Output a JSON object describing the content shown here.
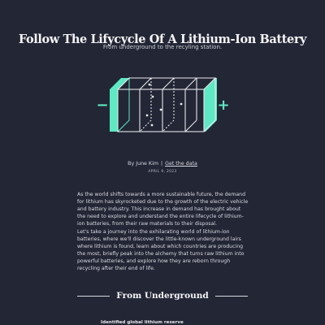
{
  "article": {
    "title": "Follow The Lifycycle Of A Lithium-Ion Battery",
    "subtitle": "From underground to the recyling station.",
    "byline": {
      "author_text": "By June Kim",
      "separator": "|",
      "data_link": "Get the data"
    },
    "date": "APRIL 9, 2023",
    "paragraphs": [
      "As the world shifts towards a more sustainable future, the demand for lithium has skyrocketed due to the growth of the electric vehicle and battery industry. This increase in demand has brought about the need to explore and understand the entire lifecycle of lithium-ion batteries, from their raw materials to their disposal.",
      "Let's take a journey into the exhilarating world of lithium-ion batteries, where we'll discover the little-known underground lairs where lithium is found, learn about which countries are producing the most, briefly peak into the alchemy that turns raw lithium into powerful batteries, and explore how they are reborn through recycling after their end of life."
    ],
    "section_heading": "From Underground",
    "chart_title": "Identified global lithium reserve"
  },
  "battery_graphic": {
    "minus_symbol": "−",
    "plus_symbol": "+",
    "accent_color": "#5ee8c4",
    "line_color": "#e6e7ea"
  }
}
